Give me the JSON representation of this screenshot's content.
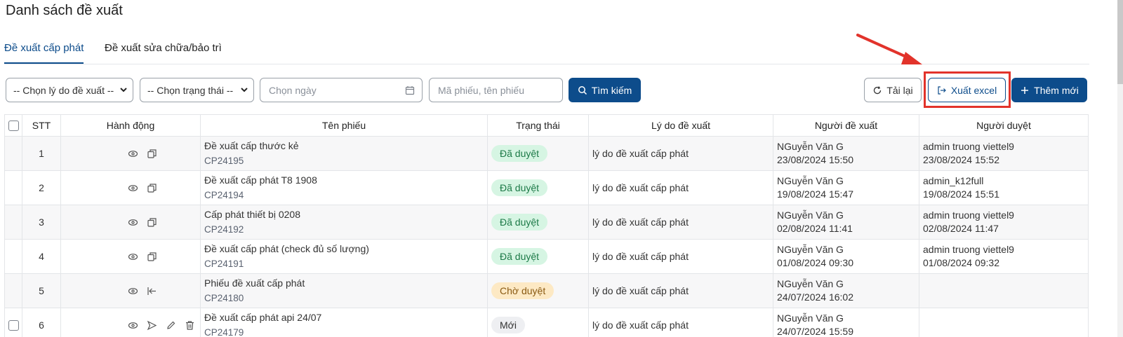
{
  "page": {
    "title": "Danh sách đề xuất"
  },
  "tabs": [
    {
      "label": "Đề xuất cấp phát",
      "active": true
    },
    {
      "label": "Đề xuất sửa chữa/bảo trì",
      "active": false
    }
  ],
  "filters": {
    "reason_select": "-- Chọn lý do đề xuất --",
    "status_select": "-- Chọn trạng thái --",
    "date_placeholder": "Chọn ngày",
    "code_placeholder": "Mã phiếu, tên phiếu",
    "search_button": "Tìm kiếm"
  },
  "toolbar": {
    "reload_button": "Tải lại",
    "export_button": "Xuất excel",
    "add_button": "Thêm mới"
  },
  "table": {
    "headers": [
      "STT",
      "Hành động",
      "Tên phiếu",
      "Trạng thái",
      "Lý do đề xuất",
      "Người đề xuất",
      "Người duyệt"
    ],
    "rows": [
      {
        "stt": "1",
        "name": "Đề xuất cấp thước kẻ",
        "code": "CP24195",
        "status": "Đã duyệt",
        "status_type": "approved",
        "reason": "lý do đề xuất cấp phát",
        "proposer": "NGuyễn Văn G",
        "proposed_at": "23/08/2024 15:50",
        "approver": "admin truong viettel9",
        "approved_at": "23/08/2024 15:52",
        "actions": [
          "eye-icon",
          "copy-icon"
        ]
      },
      {
        "stt": "2",
        "name": "Đề xuất cấp phát T8 1908",
        "code": "CP24194",
        "status": "Đã duyệt",
        "status_type": "approved",
        "reason": "lý do đề xuất cấp phát",
        "proposer": "NGuyễn Văn G",
        "proposed_at": "19/08/2024 15:47",
        "approver": "admin_k12full",
        "approved_at": "19/08/2024 15:51",
        "actions": [
          "eye-icon",
          "copy-icon"
        ]
      },
      {
        "stt": "3",
        "name": "Cấp phát thiết bị 0208",
        "code": "CP24192",
        "status": "Đã duyệt",
        "status_type": "approved",
        "reason": "lý do đề xuất cấp phát",
        "proposer": "NGuyễn Văn G",
        "proposed_at": "02/08/2024 11:41",
        "approver": "admin truong viettel9",
        "approved_at": "02/08/2024 11:47",
        "actions": [
          "eye-icon",
          "copy-icon"
        ]
      },
      {
        "stt": "4",
        "name": "Đề xuất cấp phát (check đủ số lượng)",
        "code": "CP24191",
        "status": "Đã duyệt",
        "status_type": "approved",
        "reason": "lý do đề xuất cấp phát",
        "proposer": "NGuyễn Văn G",
        "proposed_at": "01/08/2024 09:30",
        "approver": "admin truong viettel9",
        "approved_at": "01/08/2024 09:32",
        "actions": [
          "eye-icon",
          "copy-icon"
        ]
      },
      {
        "stt": "5",
        "name": "Phiếu đề xuất cấp phát",
        "code": "CP24180",
        "status": "Chờ duyệt",
        "status_type": "pending",
        "reason": "lý do đề xuất cấp phát",
        "proposer": "NGuyễn Văn G",
        "proposed_at": "24/07/2024 16:02",
        "approver": "",
        "approved_at": "",
        "actions": [
          "eye-icon",
          "withdraw-icon"
        ]
      },
      {
        "stt": "6",
        "name": "Đề xuất cấp phát api 24/07",
        "code": "CP24179",
        "status": "Mới",
        "status_type": "new",
        "reason": "lý do đề xuất cấp phát",
        "proposer": "NGuyễn Văn G",
        "proposed_at": "24/07/2024 15:59",
        "approver": "",
        "approved_at": "",
        "actions": [
          "eye-icon",
          "send-icon",
          "edit-icon",
          "trash-icon"
        ]
      }
    ]
  },
  "colors": {
    "primary": "#0d4c8b",
    "approved_bg": "#d6f5e3",
    "pending_bg": "#fde9c4",
    "new_bg": "#eeeff2",
    "highlight": "#e2332b"
  }
}
